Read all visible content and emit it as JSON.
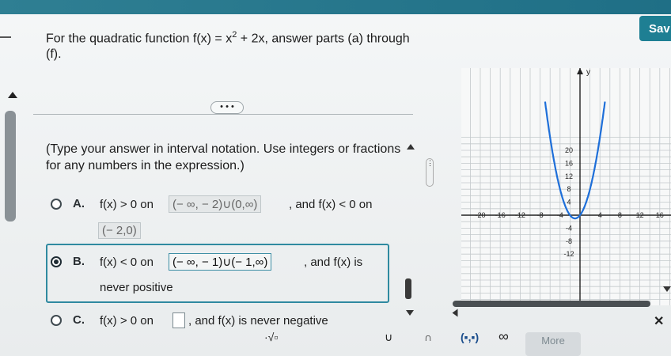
{
  "header": {
    "save_label": "Sav"
  },
  "question": {
    "prefix": "For the quadratic function f(x) = x",
    "exponent": "2",
    "suffix": " + 2x, answer parts (a) through (f).",
    "instruction": "(Type your answer in interval notation. Use integers or fractions for any numbers in the expression.)",
    "more_dots": "• • •"
  },
  "options": [
    {
      "letter": "A.",
      "pre": "f(x) > 0 on",
      "answer": "(− ∞, − 2)∪(0,∞)",
      "mid": ", and f(x) < 0 on",
      "answer2": "(− 2,0)",
      "selected": false
    },
    {
      "letter": "B.",
      "pre": "f(x) < 0 on",
      "answer": "(− ∞, − 1)∪(− 1,∞)",
      "mid": ", and f(x) is",
      "line2": "never positive",
      "selected": true
    },
    {
      "letter": "C.",
      "pre": "f(x) > 0 on",
      "answer": "",
      "mid": ", and f(x) is never negative",
      "selected": false
    }
  ],
  "graph": {
    "y_label": "y",
    "y_ticks": [
      "20",
      "16",
      "12",
      "8",
      "4",
      "-4",
      "-8",
      "-12"
    ],
    "x_ticks": [
      "-20",
      "-16",
      "-12",
      "-8",
      "-4",
      "4",
      "8",
      "12",
      "16"
    ],
    "function": "x^2 + 2x",
    "curve_color": "#1e6fd9"
  },
  "toolbar": {
    "tools": [
      "·√▫",
      "∪",
      "∩",
      "(▪,▪)",
      "∞"
    ],
    "more_label": "More"
  },
  "colors": {
    "accent": "#1e7f93",
    "selection": "#2f8aa0"
  }
}
